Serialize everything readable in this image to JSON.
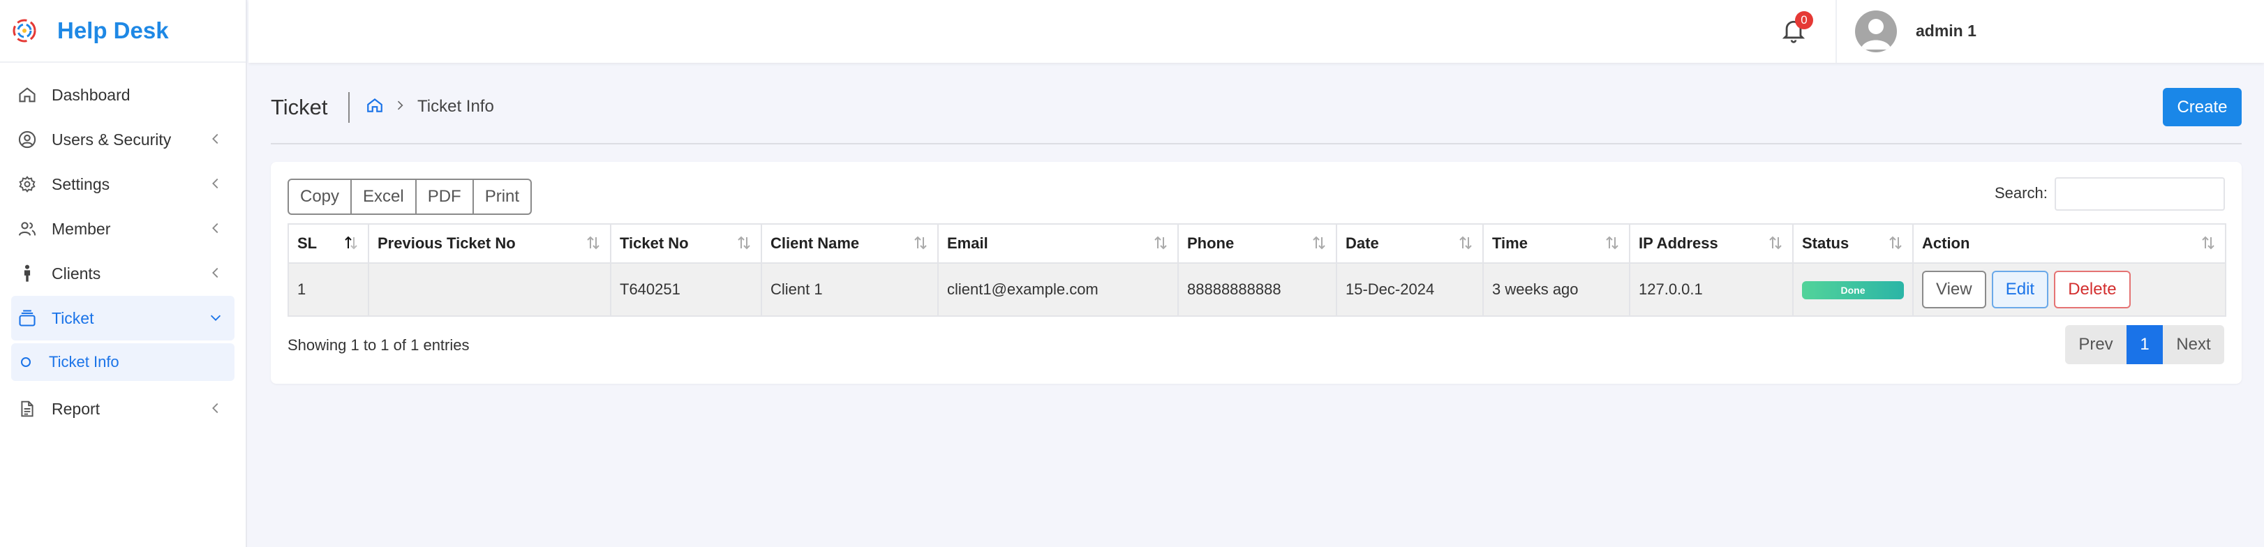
{
  "sidebar": {
    "brand": "Help Desk",
    "items": [
      {
        "label": "Dashboard",
        "icon": "home-icon"
      },
      {
        "label": "Users & Security",
        "icon": "user-circle-icon"
      },
      {
        "label": "Settings",
        "icon": "gear-icon"
      },
      {
        "label": "Member",
        "icon": "users-icon"
      },
      {
        "label": "Clients",
        "icon": "person-icon"
      },
      {
        "label": "Ticket",
        "icon": "ticket-icon"
      },
      {
        "label": "Report",
        "icon": "document-icon"
      }
    ],
    "sub_items": [
      {
        "label": "Ticket Info"
      }
    ]
  },
  "topbar": {
    "notification_count": "0",
    "username": "admin 1"
  },
  "page": {
    "title": "Ticket",
    "breadcrumb_current": "Ticket Info",
    "create_label": "Create"
  },
  "toolbar": {
    "copy": "Copy",
    "excel": "Excel",
    "pdf": "PDF",
    "print": "Print",
    "search_label": "Search:",
    "search_value": ""
  },
  "table": {
    "headers": [
      "SL",
      "Previous Ticket No",
      "Ticket No",
      "Client Name",
      "Email",
      "Phone",
      "Date",
      "Time",
      "IP Address",
      "Status",
      "Action"
    ],
    "rows": [
      {
        "sl": "1",
        "previous_ticket_no": "",
        "ticket_no": "T640251",
        "client_name": "Client 1",
        "email": "client1@example.com",
        "phone": "88888888888",
        "date": "15-Dec-2024",
        "time": "3 weeks ago",
        "ip": "127.0.0.1",
        "status": "Done",
        "actions": {
          "view": "View",
          "edit": "Edit",
          "delete": "Delete"
        }
      }
    ]
  },
  "footer": {
    "entries_text": "Showing 1 to 1 of 1 entries",
    "prev": "Prev",
    "page": "1",
    "next": "Next"
  },
  "colors": {
    "primary": "#1a87e8",
    "badge_red": "#e53935",
    "status_done": "#3cc4a0",
    "delete_red": "#d32f2f"
  }
}
